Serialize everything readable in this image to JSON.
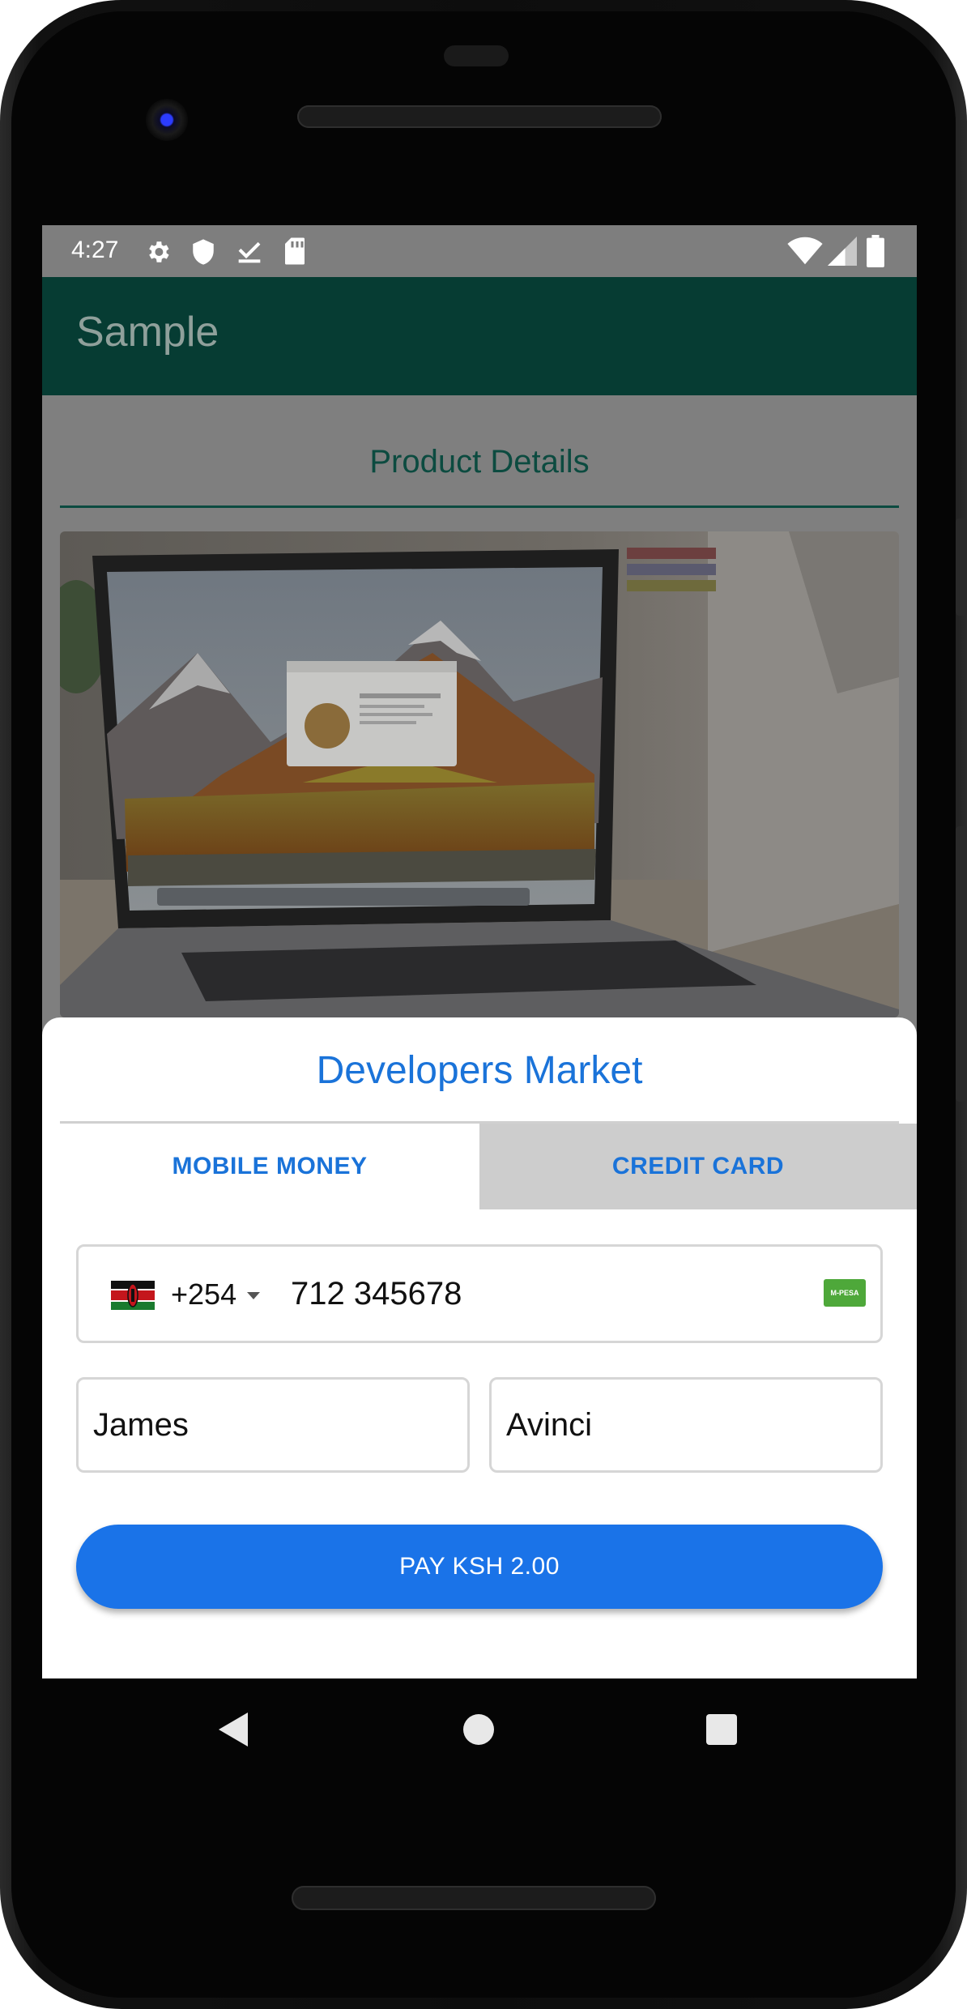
{
  "status_bar": {
    "time": "4:27",
    "left_icons": [
      "gear-icon",
      "shield-icon",
      "check-download-icon",
      "sd-card-icon"
    ],
    "right_icons": [
      "wifi-icon",
      "signal-icon",
      "battery-icon"
    ]
  },
  "app_bar": {
    "title": "Sample"
  },
  "product": {
    "section_title": "Product Details",
    "image": "laptop-photo"
  },
  "payment_sheet": {
    "title": "Developers Market",
    "tabs": [
      {
        "label": "MOBILE MONEY",
        "selected": true
      },
      {
        "label": "CREDIT CARD",
        "selected": false
      }
    ],
    "phone": {
      "country_flag": "kenya-flag",
      "country_code": "+254",
      "number": "712 345678",
      "provider_badge": "M-PESA"
    },
    "first_name": "James",
    "last_name": "Avinci",
    "pay_button_label": "PAY  KSH 2.00"
  },
  "nav_bar": {
    "icons": [
      "back-icon",
      "home-icon",
      "recent-apps-icon"
    ]
  },
  "colors": {
    "app_bar": "#063c33",
    "accent_blue": "#1a73e8",
    "scrim": "#7f7f7f"
  }
}
